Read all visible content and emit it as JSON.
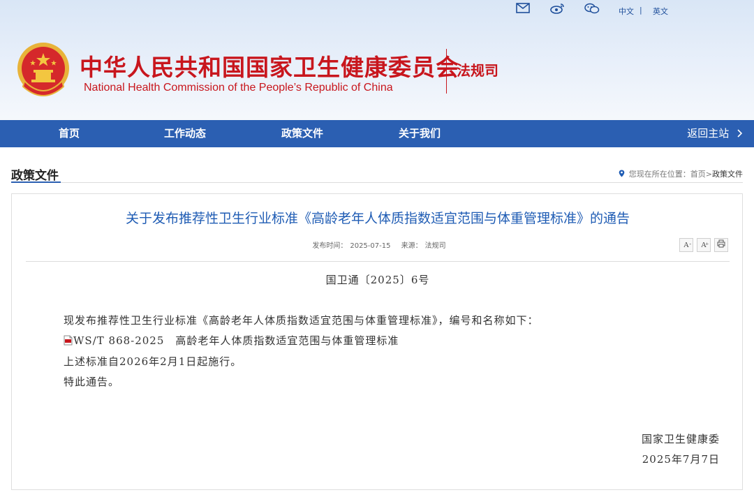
{
  "topbar": {
    "icons": [
      "mail-icon",
      "weibo-icon",
      "wechat-icon"
    ],
    "lang_cn": "中文",
    "lang_sep": "|",
    "lang_en": "英文"
  },
  "header": {
    "title_cn": "中华人民共和国国家卫生健康委员会",
    "title_en": "National Health Commission of the People’s  Republic of China",
    "department": "法规司"
  },
  "nav": {
    "items": [
      {
        "label": "首页"
      },
      {
        "label": "工作动态"
      },
      {
        "label": "政策文件"
      },
      {
        "label": "关于我们"
      }
    ],
    "back_label": "返回主站"
  },
  "section": {
    "title": "政策文件",
    "breadcrumb_prefix": "您现在所在位置：",
    "breadcrumb_home": "首页",
    "breadcrumb_sep": ">",
    "breadcrumb_current": "政策文件"
  },
  "article": {
    "title": "关于发布推荐性卫生行业标准《高龄老年人体质指数适宜范围与体重管理标准》的通告",
    "publish_time_label": "发布时间：",
    "publish_time": "2025-07-15",
    "source_label": "来源：",
    "source": "法规司",
    "tools": [
      "A-",
      "A+",
      "print"
    ],
    "doc_number": "国卫通〔2025〕6号",
    "para1": "现发布推荐性卫生行业标准《高龄老年人体质指数适宜范围与体重管理标准》，编号和名称如下：",
    "standard_link": "WS/T 868-2025　高龄老年人体质指数适宜范围与体重管理标准",
    "para2": "上述标准自2026年2月1日起施行。",
    "para3": "特此通告。",
    "signer": "国家卫生健康委",
    "date": "2025年7月7日"
  },
  "colors": {
    "brand_red": "#c8161d",
    "nav_blue": "#2b5fb2",
    "title_blue": "#1f5cb4"
  }
}
